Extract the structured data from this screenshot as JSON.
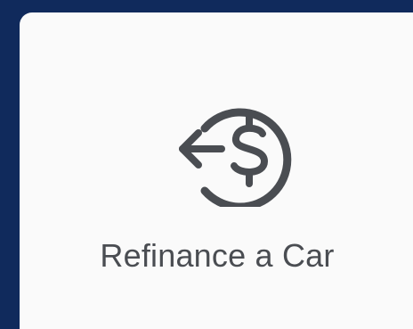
{
  "card": {
    "label": "Refinance a Car",
    "icon": "refinance-dollar-arrow-icon"
  },
  "colors": {
    "background": "#102a5c",
    "card": "#fafafa",
    "icon": "#4a4d52",
    "text": "#4a4d52"
  }
}
